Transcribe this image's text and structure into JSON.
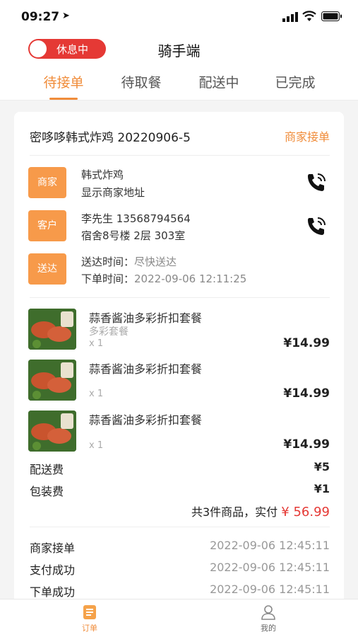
{
  "status_bar": {
    "time": "09:27",
    "arrow": "➤"
  },
  "header": {
    "toggle_label": "休息中",
    "title": "骑手端"
  },
  "tabs": [
    {
      "label": "待接单",
      "active": true
    },
    {
      "label": "待取餐",
      "active": false
    },
    {
      "label": "配送中",
      "active": false
    },
    {
      "label": "已完成",
      "active": false
    }
  ],
  "order": {
    "number": "密哆哆韩式炸鸡  20220906-5",
    "status": "商家接单",
    "merchant": {
      "badge": "商家",
      "name": "韩式炸鸡",
      "address": "显示商家地址"
    },
    "customer": {
      "badge": "客户",
      "name_phone": "李先生  13568794564",
      "address": "宿舍8号楼 2层 303室"
    },
    "delivery": {
      "badge": "送达",
      "arrive_label": "送达时间：",
      "arrive_value": "尽快送达",
      "order_label": "下单时间：",
      "order_value": "2022-09-06 12:11:25"
    },
    "items": [
      {
        "name": "蒜香酱油多彩折扣套餐",
        "sub": "多彩套餐",
        "qty": "x 1",
        "price": "¥14.99"
      },
      {
        "name": "蒜香酱油多彩折扣套餐",
        "sub": "",
        "qty": "x 1",
        "price": "¥14.99"
      },
      {
        "name": "蒜香酱油多彩折扣套餐",
        "sub": "",
        "qty": "x 1",
        "price": "¥14.99"
      }
    ],
    "fees": {
      "delivery_label": "配送费",
      "delivery_value": "¥5",
      "package_label": "包装费",
      "package_value": "¥1"
    },
    "total": {
      "prefix": "共3件商品，实付 ",
      "amount": "¥ 56.99"
    },
    "log": [
      {
        "label": "商家接单",
        "time": "2022-09-06  12:45:11"
      },
      {
        "label": "支付成功",
        "time": "2022-09-06  12:45:11"
      },
      {
        "label": "下单成功",
        "time": "2022-09-06  12:45:11"
      }
    ]
  },
  "bottom_nav": [
    {
      "label": "订单",
      "icon": "order-icon",
      "active": true
    },
    {
      "label": "我的",
      "icon": "profile-icon",
      "active": false
    }
  ],
  "colors": {
    "accent": "#f08c3a",
    "badge": "#f79a4a",
    "danger": "#e53935"
  }
}
